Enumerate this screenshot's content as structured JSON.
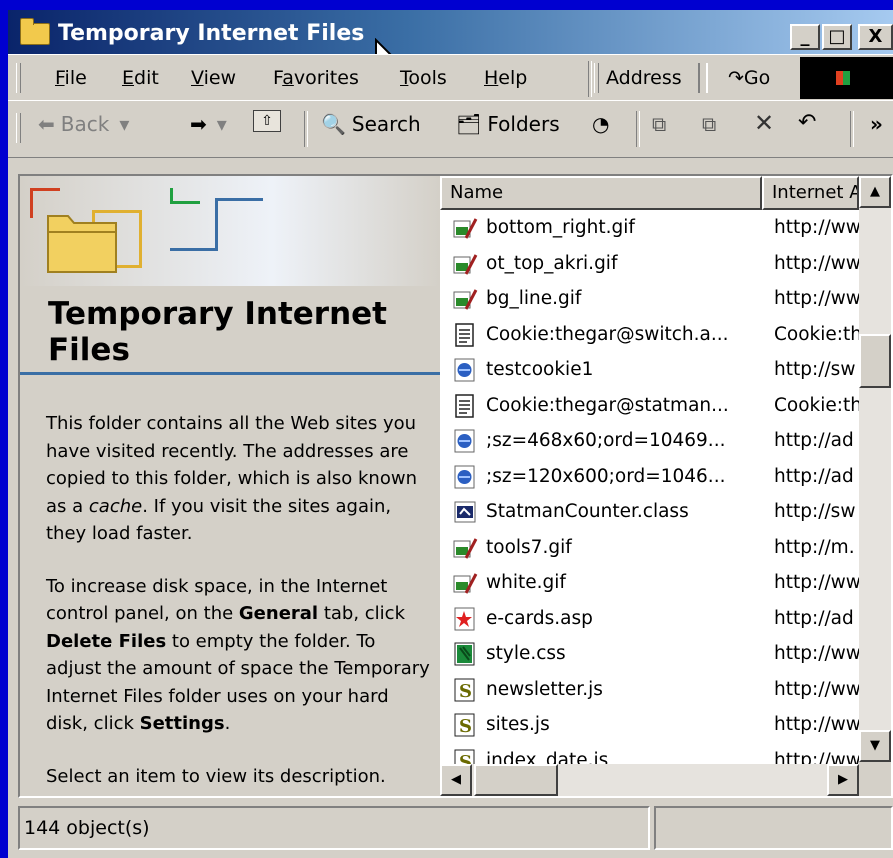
{
  "window": {
    "title": "Temporary Internet Files",
    "controls": [
      "_",
      "□",
      "X"
    ]
  },
  "menu": {
    "items": [
      {
        "label": "File",
        "u": "F"
      },
      {
        "label": "Edit",
        "u": "E"
      },
      {
        "label": "View",
        "u": "V"
      },
      {
        "label": "Favorites",
        "u": "a"
      },
      {
        "label": "Tools",
        "u": "T"
      },
      {
        "label": "Help",
        "u": "H"
      }
    ],
    "address_label": "Address",
    "go_label": "Go"
  },
  "toolbar": {
    "back_label": "Back",
    "search_label": "Search",
    "folders_label": "Folders",
    "more_label": "»"
  },
  "left_panel": {
    "title": "Temporary Internet Files",
    "para1_a": "This folder contains all the Web sites you have visited recently. The addresses are copied to this folder, which is also known as a ",
    "para1_em": "cache",
    "para1_b": ". If you visit the sites again, they load faster.",
    "para2_a": "To increase disk space, in the Internet control panel, on the ",
    "para2_b1": "General",
    "para2_c": " tab, click ",
    "para2_b2": "Delete Files",
    "para2_d": " to empty the folder. To adjust the amount of space the Temporary Internet Files folder uses on your hard disk, click ",
    "para2_b3": "Settings",
    "para2_e": ".",
    "para3": "Select an item to view its description."
  },
  "list": {
    "columns": [
      "Name",
      "Internet Address"
    ],
    "rows": [
      {
        "name": "bottom_right.gif",
        "addr": "http://ww",
        "icon": "gif-image-icon"
      },
      {
        "name": "ot_top_akri.gif",
        "addr": "http://ww",
        "icon": "gif-image-icon"
      },
      {
        "name": "bg_line.gif",
        "addr": "http://ww",
        "icon": "gif-image-icon"
      },
      {
        "name": "Cookie:thegar@switch.a...",
        "addr": "Cookie:th",
        "icon": "cookie-text-icon"
      },
      {
        "name": "testcookie1",
        "addr": "http://sw",
        "icon": "ie-document-icon"
      },
      {
        "name": "Cookie:thegar@statman...",
        "addr": "Cookie:th",
        "icon": "cookie-text-icon"
      },
      {
        "name": ";sz=468x60;ord=10469...",
        "addr": "http://ad",
        "icon": "ie-document-icon"
      },
      {
        "name": ";sz=120x600;ord=1046...",
        "addr": "http://ad",
        "icon": "ie-document-icon"
      },
      {
        "name": "StatmanCounter.class",
        "addr": "http://sw",
        "icon": "java-class-icon"
      },
      {
        "name": "tools7.gif",
        "addr": "http://m.",
        "icon": "gif-image-icon"
      },
      {
        "name": "white.gif",
        "addr": "http://ww",
        "icon": "gif-image-icon"
      },
      {
        "name": "e-cards.asp",
        "addr": "http://ad",
        "icon": "asp-file-icon"
      },
      {
        "name": "style.css",
        "addr": "http://ww",
        "icon": "css-file-icon"
      },
      {
        "name": "newsletter.js",
        "addr": "http://ww",
        "icon": "js-script-icon"
      },
      {
        "name": "sites.js",
        "addr": "http://ww",
        "icon": "js-script-icon"
      },
      {
        "name": "index_date.js",
        "addr": "http://ww",
        "icon": "js-script-icon"
      }
    ]
  },
  "status": {
    "objects": "144 object(s)"
  }
}
